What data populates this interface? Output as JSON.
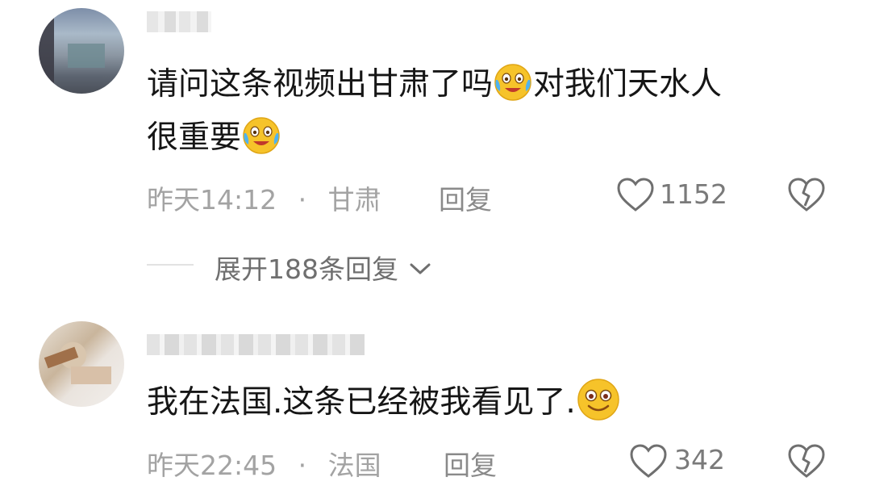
{
  "comments": [
    {
      "text_line1_a": "请问这条视频出甘肃了吗",
      "emoji1": "crying-laughing-emoji",
      "text_line1_b": "对我们天水人",
      "text_line2": "很重要",
      "emoji2": "crying-laughing-emoji",
      "time": "昨天14:12",
      "separator": "·",
      "location": "甘肃",
      "reply_label": "回复",
      "likes": "1152",
      "expand_replies": "展开188条回复"
    },
    {
      "text": "我在法国.这条已经被我看见了.",
      "emoji": "smiling-emoji",
      "time": "昨天22:45",
      "separator": "·",
      "location": "法国",
      "reply_label": "回复",
      "likes": "342"
    }
  ],
  "colors": {
    "text": "#161616",
    "meta": "#a3a3a3",
    "emoji_yellow": "#f6c32a"
  }
}
